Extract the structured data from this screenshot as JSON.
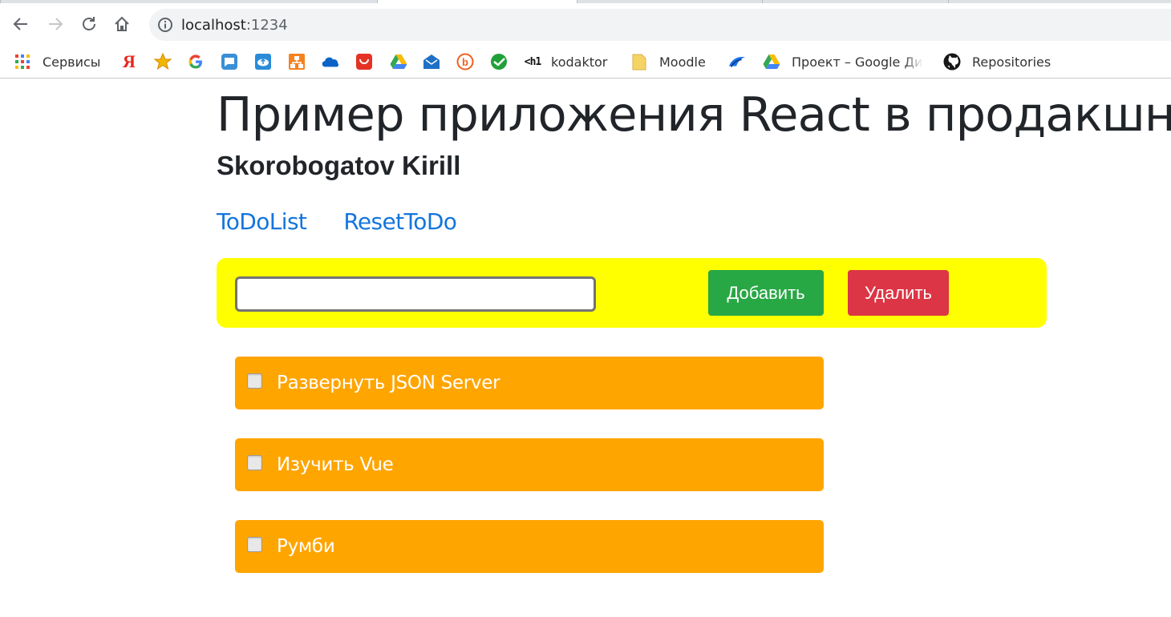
{
  "browser": {
    "url_host": "localhost",
    "url_port": ":1234",
    "bookmarks": [
      {
        "label": "Сервисы",
        "icon": "apps-grid-icon"
      },
      {
        "label": "",
        "icon": "yandex-icon"
      },
      {
        "label": "",
        "icon": "star-icon"
      },
      {
        "label": "",
        "icon": "google-icon"
      },
      {
        "label": "",
        "icon": "chat-icon"
      },
      {
        "label": "",
        "icon": "cloud-upload-icon"
      },
      {
        "label": "",
        "icon": "org-chart-icon"
      },
      {
        "label": "",
        "icon": "onedrive-icon"
      },
      {
        "label": "",
        "icon": "aliexpress-icon"
      },
      {
        "label": "",
        "icon": "google-drive-icon"
      },
      {
        "label": "",
        "icon": "mail-icon"
      },
      {
        "label": "",
        "icon": "b-icon"
      },
      {
        "label": "",
        "icon": "sberbank-icon"
      },
      {
        "label": "",
        "icon": "h1-icon"
      },
      {
        "label": "kodaktor",
        "icon": "folder-icon"
      },
      {
        "label": "Moodle",
        "icon": "moodle-icon"
      },
      {
        "label": "Проект – Google Ди",
        "icon": "google-drive-icon"
      },
      {
        "label": "Repositories",
        "icon": "github-icon"
      }
    ],
    "yandex_glyph": "Я",
    "h1_glyph": "<h1"
  },
  "page": {
    "title": "Пример приложения React в продакшн",
    "subtitle": "Skorobogatov Kirill",
    "nav": [
      {
        "label": "ToDoList"
      },
      {
        "label": "ResetToDo"
      }
    ],
    "form": {
      "input_value": "",
      "input_placeholder": "",
      "add_label": "Добавить",
      "delete_label": "Удалить"
    },
    "todos": [
      {
        "text": "Развернуть JSON Server",
        "checked": false
      },
      {
        "text": "Изучить Vue",
        "checked": false
      },
      {
        "text": "Румби",
        "checked": false
      }
    ]
  },
  "colors": {
    "form_bg": "#ffff00",
    "todo_bg": "#ffa500",
    "add_button": "#28a745",
    "delete_button": "#dc3545",
    "link": "#1475dd"
  }
}
